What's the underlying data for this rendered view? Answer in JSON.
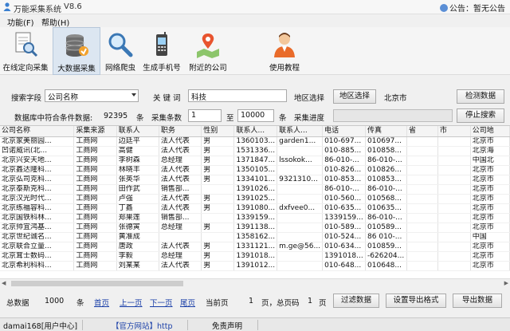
{
  "window": {
    "title": "万能采集系统",
    "version": "V8.6",
    "notice": "公告：暂无公告"
  },
  "menu": [
    "功能(F)",
    "帮助(H)"
  ],
  "toolbar": [
    {
      "label": "在线定向采集",
      "icon": "document-search-icon"
    },
    {
      "label": "大数据采集",
      "icon": "database-icon",
      "active": true
    },
    {
      "label": "网络爬虫",
      "icon": "magnifier-icon"
    },
    {
      "label": "生成手机号",
      "icon": "mobile-phone-icon"
    },
    {
      "label": "附近的公司",
      "icon": "map-pin-icon"
    },
    {
      "label": "使用教程",
      "icon": "user-tutorial-icon"
    }
  ],
  "search": {
    "field_label": "搜索字段",
    "field_value": "公司名称",
    "keyword_label": "关 键 词",
    "keyword_value": "科技",
    "region_label": "地区选择",
    "region_button": "地区选择",
    "region_value": "北京市",
    "detect_button": "检测数据",
    "count_label": "数据库中符合条件数据:",
    "count_value": "92395",
    "count_unit": "条",
    "collect_label": "采集条数",
    "collect_from": "1",
    "to_label": "至",
    "collect_to": "10000",
    "collect_unit": "条",
    "progress_label": "采集进度",
    "stop_button": "停止搜索"
  },
  "grid": {
    "columns": [
      "公司名称",
      "采集来源",
      "联系人",
      "职务",
      "性别",
      "联系人...",
      "联系人...",
      "电话",
      "传真",
      "省",
      "市",
      "公司地"
    ],
    "rows": [
      [
        "北京家美丽园...",
        "工商网",
        "边廷平",
        "法人代表",
        "男",
        "1360103...",
        "garden1...",
        "010-697...",
        "010697...",
        "",
        "",
        "北京市"
      ],
      [
        "凹诺威讯(北...",
        "工商网",
        "高健",
        "法人代表",
        "男",
        "1531336...",
        "",
        "010-885...",
        "010858...",
        "",
        "",
        "北京海"
      ],
      [
        "北京兴安天地...",
        "工商网",
        "李树森",
        "总经理",
        "男",
        "1371847...",
        "lssokok...",
        "86-010-...",
        "86-010-...",
        "",
        "",
        "中国北"
      ],
      [
        "北京鑫达隆科...",
        "工商网",
        "林晓丰",
        "法人代表",
        "男",
        "1350105...",
        "",
        "010-826...",
        "010826...",
        "",
        "",
        "北京市"
      ],
      [
        "北京弘司克科...",
        "工商网",
        "张英华",
        "法人代表",
        "男",
        "1334101...",
        "9321310...",
        "010-853...",
        "010853...",
        "",
        "",
        "北京市"
      ],
      [
        "北京泰斯克科...",
        "工商网",
        "田作武",
        "销售部...",
        "",
        "1391026...",
        "",
        "86-010-...",
        "86-010-...",
        "",
        "",
        "北京市"
      ],
      [
        "北京汉光时代...",
        "工商网",
        "卢强",
        "法人代表",
        "男",
        "1391025...",
        "",
        "010-560...",
        "010568...",
        "",
        "",
        "北京市"
      ],
      [
        "北京练福容科...",
        "工商网",
        "丁鑫",
        "法人代表",
        "男",
        "1391080...",
        "dxfvee0...",
        "010-635...",
        "010635...",
        "",
        "",
        "北京市"
      ],
      [
        "北京国铁科林...",
        "工商网",
        "郑果莲",
        "销售部...",
        "",
        "1339159...",
        "",
        "1339159...",
        "86-010-...",
        "",
        "",
        "北京市"
      ],
      [
        "北京帅宜鸿基...",
        "工商网",
        "张德寅",
        "总经理",
        "男",
        "1391138...",
        "",
        "010-589...",
        "010589...",
        "",
        "",
        "北京市"
      ],
      [
        "北京世纪诚名...",
        "工商网",
        "黄准成",
        "",
        "",
        "1358162...",
        "",
        "010-524...",
        "86 010-...",
        "",
        "",
        "中国"
      ],
      [
        "北京联合立量...",
        "工商网",
        "唐政",
        "法人代表",
        "男",
        "1331121...",
        "m.ge@56...",
        "010-634...",
        "010859...",
        "",
        "",
        "北京市"
      ],
      [
        "北京茸士数码...",
        "工商网",
        "李毅",
        "总经理",
        "男",
        "1391018...",
        "",
        "1391018...",
        "-626204...",
        "",
        "",
        "北京市"
      ],
      [
        "北京希利科科...",
        "工商网",
        "刘某某",
        "法人代表",
        "男",
        "1391012...",
        "",
        "010-648...",
        "010648...",
        "",
        "",
        "北京市"
      ]
    ]
  },
  "footer": {
    "total_label": "总数据",
    "total_value": "1000",
    "total_unit": "条",
    "first": "首页",
    "prev": "上一页",
    "next": "下一页",
    "last": "尾页",
    "current_label": "当前页",
    "current_value": "1",
    "pages_text": "页，总页码",
    "pages_value": "1",
    "pages_unit": "页",
    "filter_button": "过滤数据",
    "export_format_button": "设置导出格式",
    "export_button": "导出数据"
  },
  "status": {
    "user": "damai168[用户中心]",
    "site": "【官方网站】http",
    "disclaimer": "免责声明"
  },
  "colors": {
    "link": "#1a3fa8",
    "active_tool": "#dce6f1",
    "status_site": "#1a3fa8"
  }
}
